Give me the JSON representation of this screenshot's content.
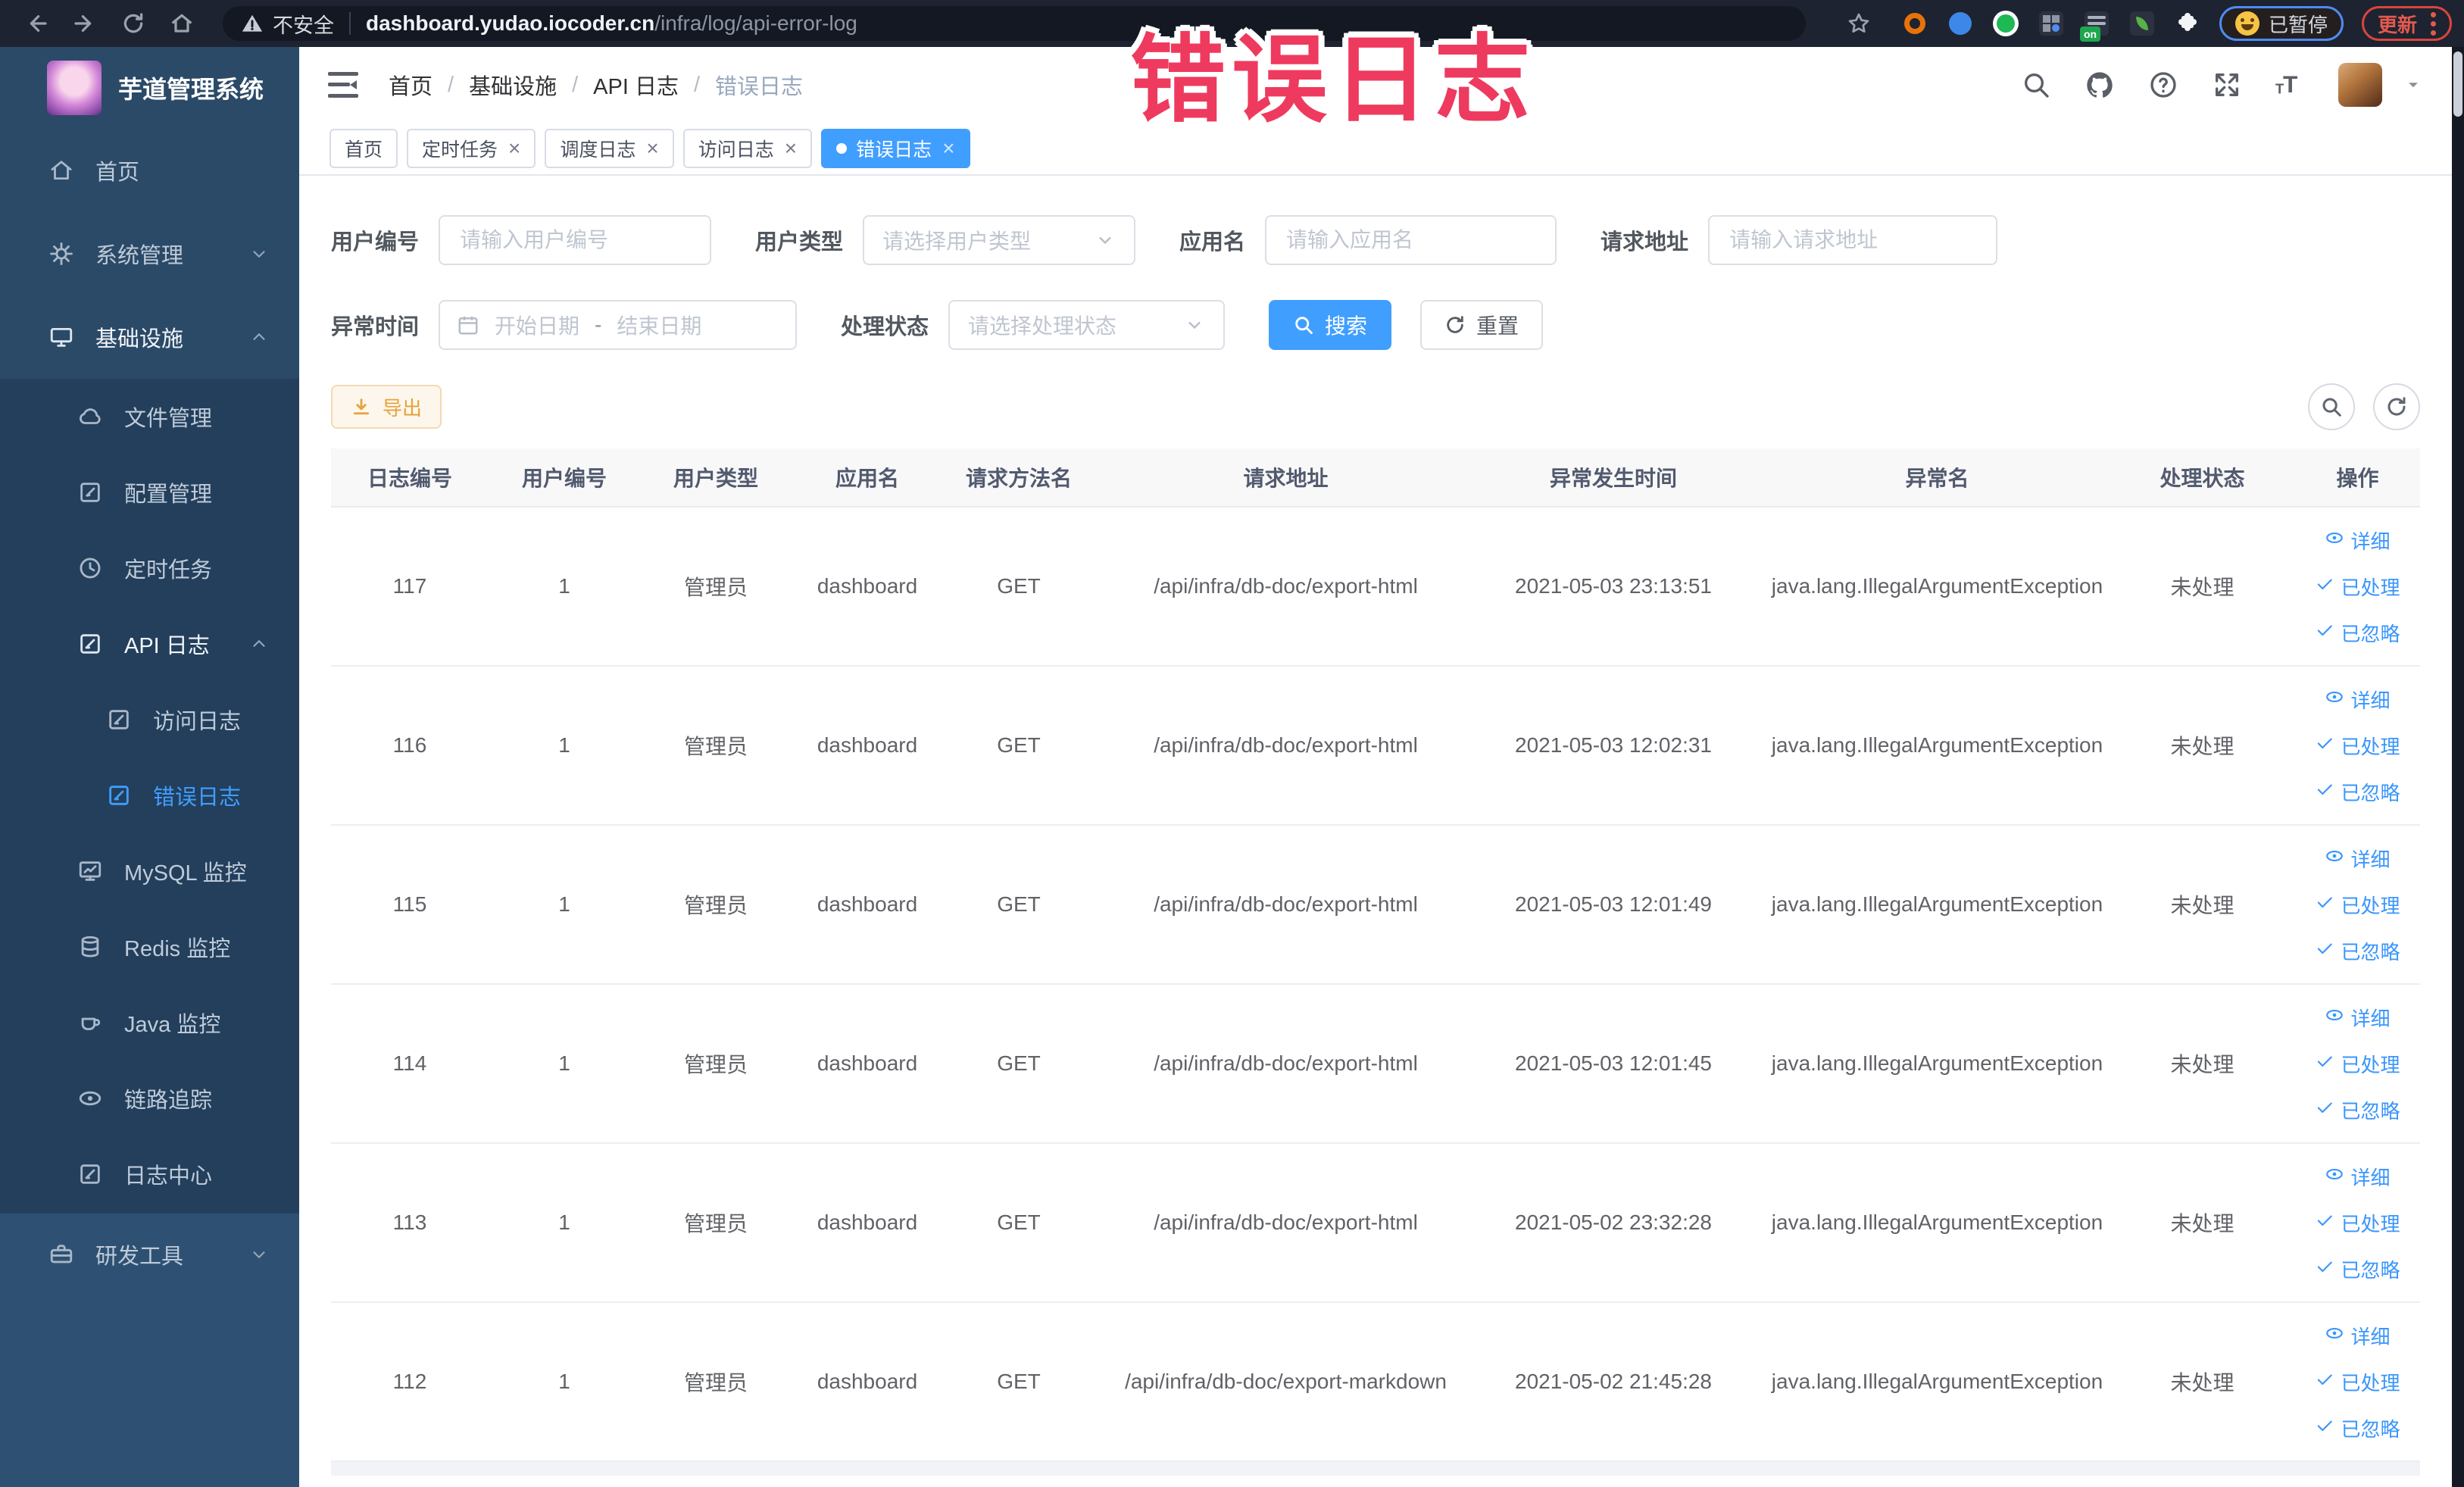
{
  "theme": {
    "accent": "#409eff",
    "warning": "#e6a23c",
    "link": "#3a96fb",
    "overlay": "#ee3a5e",
    "sidebar_base": "#2b4a68",
    "sidebar_sub": "#233f5c",
    "sidebar_bottom": "#2e5173"
  },
  "browser": {
    "security_label": "不安全",
    "url_host": "dashboard.yudao.iocoder.cn",
    "url_path": "/infra/log/api-error-log",
    "paused_chip": "已暂停",
    "update_chip": "更新",
    "extensions": [
      {
        "name": "ext-orange-ring-icon",
        "style": "ring",
        "color": "#e8710a"
      },
      {
        "name": "ext-blue-shield-icon",
        "style": "circle",
        "color": "#3d87e8"
      },
      {
        "name": "ext-green-circle-icon",
        "style": "circle-ring",
        "color": "#1db954"
      },
      {
        "name": "ext-grid-icon",
        "style": "grid",
        "color": "#2c3140"
      },
      {
        "name": "ext-on-switch-icon",
        "style": "lines-badge",
        "color": "#2c3140",
        "badge": "on"
      },
      {
        "name": "ext-leaf-icon",
        "style": "leaf",
        "color": "#2c3140"
      },
      {
        "name": "extensions-puzzle-icon",
        "style": "puzzle",
        "color": "#f2f4f7"
      }
    ]
  },
  "sidebar": {
    "logo_title": "芋道管理系统",
    "items": [
      {
        "label": "首页",
        "icon": "home-icon",
        "level": 1,
        "section": "base"
      },
      {
        "label": "系统管理",
        "icon": "gear-icon",
        "level": 1,
        "section": "base",
        "arrow": "down"
      },
      {
        "label": "基础设施",
        "icon": "monitor-icon",
        "level": 1,
        "section": "base",
        "arrow": "up",
        "open": true
      },
      {
        "label": "文件管理",
        "icon": "cloud-icon",
        "level": 2,
        "section": "sub"
      },
      {
        "label": "配置管理",
        "icon": "edit-icon",
        "level": 2,
        "section": "sub"
      },
      {
        "label": "定时任务",
        "icon": "clock-icon",
        "level": 2,
        "section": "sub"
      },
      {
        "label": "API 日志",
        "icon": "log-icon",
        "level": 2,
        "section": "sub",
        "arrow": "up",
        "open": true
      },
      {
        "label": "访问日志",
        "icon": "log-icon",
        "level": 3,
        "section": "sub"
      },
      {
        "label": "错误日志",
        "icon": "log-icon",
        "level": 3,
        "section": "sub",
        "active": true
      },
      {
        "label": "MySQL 监控",
        "icon": "chart-icon",
        "level": 2,
        "section": "sub"
      },
      {
        "label": "Redis 监控",
        "icon": "database-icon",
        "level": 2,
        "section": "sub"
      },
      {
        "label": "Java 监控",
        "icon": "coffee-icon",
        "level": 2,
        "section": "sub"
      },
      {
        "label": "链路追踪",
        "icon": "eye-icon",
        "level": 2,
        "section": "sub"
      },
      {
        "label": "日志中心",
        "icon": "log-icon",
        "level": 2,
        "section": "sub"
      },
      {
        "label": "研发工具",
        "icon": "briefcase-icon",
        "level": 1,
        "section": "bottom",
        "arrow": "down"
      }
    ]
  },
  "header": {
    "breadcrumb": [
      "首页",
      "基础设施",
      "API 日志",
      "错误日志"
    ],
    "separator": "/",
    "actions": [
      "search-icon",
      "github-icon",
      "help-icon",
      "fullscreen-icon",
      "font-size-icon"
    ]
  },
  "tabs": [
    {
      "label": "首页"
    },
    {
      "label": "定时任务",
      "closable": true
    },
    {
      "label": "调度日志",
      "closable": true
    },
    {
      "label": "访问日志",
      "closable": true
    },
    {
      "label": "错误日志",
      "closable": true,
      "active": true
    }
  ],
  "overlay_title": "错误日志",
  "filters": {
    "user_id_label": "用户编号",
    "user_id_placeholder": "请输入用户编号",
    "user_type_label": "用户类型",
    "user_type_placeholder": "请选择用户类型",
    "app_name_label": "应用名",
    "app_name_placeholder": "请输入应用名",
    "request_url_label": "请求地址",
    "request_url_placeholder": "请输入请求地址",
    "time_label": "异常时间",
    "time_start_placeholder": "开始日期",
    "time_separator": "-",
    "time_end_placeholder": "结束日期",
    "status_label": "处理状态",
    "status_placeholder": "请选择处理状态",
    "search_button": "搜索",
    "reset_button": "重置"
  },
  "toolbar": {
    "export_button": "导出"
  },
  "table": {
    "columns": [
      {
        "label": "日志编号"
      },
      {
        "label": "用户编号"
      },
      {
        "label": "用户类型"
      },
      {
        "label": "应用名"
      },
      {
        "label": "请求方法名"
      },
      {
        "label": "请求地址"
      },
      {
        "label": "异常发生时间"
      },
      {
        "label": "异常名"
      },
      {
        "label": "处理状态"
      },
      {
        "label": "操作"
      }
    ],
    "row_actions": [
      {
        "label": "详细",
        "icon": "eye-icon"
      },
      {
        "label": "已处理",
        "icon": "check-icon"
      },
      {
        "label": "已忽略",
        "icon": "check-icon"
      }
    ],
    "rows": [
      {
        "id": "117",
        "user_id": "1",
        "user_type": "管理员",
        "app": "dashboard",
        "method": "GET",
        "url": "/api/infra/db-doc/export-html",
        "time": "2021-05-03 23:13:51",
        "exception": "java.lang.IllegalArgumentException",
        "status": "未处理"
      },
      {
        "id": "116",
        "user_id": "1",
        "user_type": "管理员",
        "app": "dashboard",
        "method": "GET",
        "url": "/api/infra/db-doc/export-html",
        "time": "2021-05-03 12:02:31",
        "exception": "java.lang.IllegalArgumentException",
        "status": "未处理"
      },
      {
        "id": "115",
        "user_id": "1",
        "user_type": "管理员",
        "app": "dashboard",
        "method": "GET",
        "url": "/api/infra/db-doc/export-html",
        "time": "2021-05-03 12:01:49",
        "exception": "java.lang.IllegalArgumentException",
        "status": "未处理"
      },
      {
        "id": "114",
        "user_id": "1",
        "user_type": "管理员",
        "app": "dashboard",
        "method": "GET",
        "url": "/api/infra/db-doc/export-html",
        "time": "2021-05-03 12:01:45",
        "exception": "java.lang.IllegalArgumentException",
        "status": "未处理"
      },
      {
        "id": "113",
        "user_id": "1",
        "user_type": "管理员",
        "app": "dashboard",
        "method": "GET",
        "url": "/api/infra/db-doc/export-html",
        "time": "2021-05-02 23:32:28",
        "exception": "java.lang.IllegalArgumentException",
        "status": "未处理"
      },
      {
        "id": "112",
        "user_id": "1",
        "user_type": "管理员",
        "app": "dashboard",
        "method": "GET",
        "url": "/api/infra/db-doc/export-markdown",
        "time": "2021-05-02 21:45:28",
        "exception": "java.lang.IllegalArgumentException",
        "status": "未处理"
      }
    ]
  }
}
